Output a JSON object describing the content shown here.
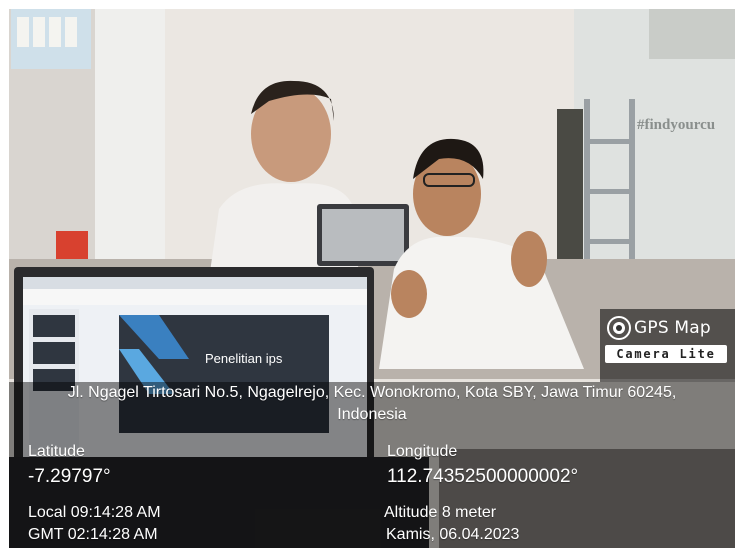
{
  "background_text": {
    "wall_sign": "#findyourcu"
  },
  "slide": {
    "title": "Penelitian ips"
  },
  "watermark": {
    "app_name": "GPS Map",
    "app_sub": "Camera Lite"
  },
  "address": {
    "line1": "Jl. Ngagel Tirtosari No.5, Ngagelrejo, Kec. Wonokromo, Kota SBY, Jawa Timur 60245,",
    "line2": "Indonesia"
  },
  "coords": {
    "lat_label": "Latitude",
    "lat_value": "-7.29797°",
    "lon_label": "Longitude",
    "lon_value": "112.74352500000002°"
  },
  "info": {
    "local_time": "Local 09:14:28 AM",
    "gmt_time": "GMT 02:14:28 AM",
    "altitude": "Altitude 8 meter",
    "date": "Kamis, 06.04.2023"
  },
  "colors": {
    "wall": "#e6e2dd",
    "overlay": "#000000",
    "laptop": "#2b2b2d",
    "slide_bg": "#2f3640",
    "slide_accent": "#3a80c0"
  }
}
